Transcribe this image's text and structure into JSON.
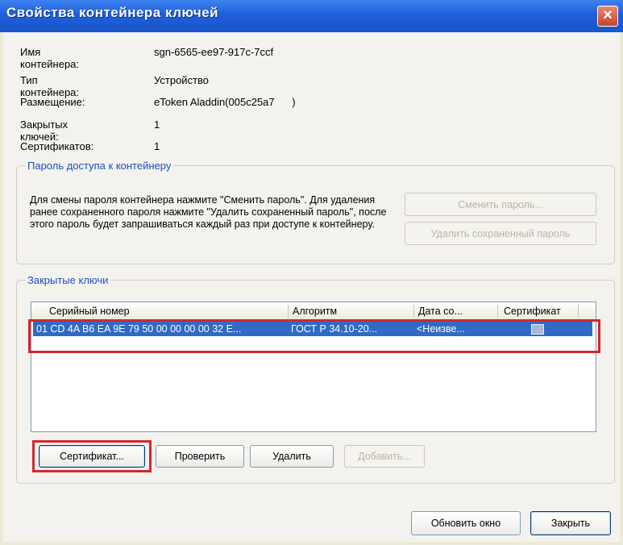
{
  "window": {
    "title": "Свойства контейнера ключей",
    "close_glyph": "✕"
  },
  "info": [
    {
      "label": "Имя контейнера:",
      "value": "sgn-6565-ee97-917c-7ccf"
    },
    {
      "label": "Тип контейнера:",
      "value": "Устройство"
    },
    {
      "label": "Размещение:",
      "value": "eToken Aladdin(005c25a7      )"
    },
    {
      "label": "Закрытых ключей:",
      "value": "1"
    },
    {
      "label": "Сертификатов:",
      "value": "1"
    }
  ],
  "password_group": {
    "legend": "Пароль доступа к контейнеру",
    "text": "Для смены пароля контейнера нажмите \"Сменить пароль\". Для удаления ранее сохраненного пароля нажмите \"Удалить сохраненный пароль\", после этого пароль будет запрашиваться каждый раз при доступе к контейнеру.",
    "change_label": "Сменить пароль...",
    "delete_label": "Удалить сохраненный пароль"
  },
  "keys_group": {
    "legend": "Закрытые ключи",
    "columns": [
      "Серийный номер",
      "Алгоритм",
      "Дата со...",
      "Сертификат"
    ],
    "rows": [
      {
        "serial": "01 CD 4A B6 EA 9E 79 50 00 00 00 00 32 E...",
        "algorithm": "ГОСТ Р 34.10-20...",
        "date": "<Неизве...",
        "certificate": "cert-icon"
      }
    ],
    "buttons": {
      "certificate": "Сертификат...",
      "check": "Проверить",
      "delete": "Удалить",
      "add": "Добавить..."
    }
  },
  "footer": {
    "refresh_label": "Обновить окно",
    "close_label": "Закрыть"
  },
  "colors": {
    "title_bar": "#1f5fd8",
    "selection": "#316ac5",
    "highlight_box": "#d4262f",
    "group_legend": "#1f4fbf"
  }
}
